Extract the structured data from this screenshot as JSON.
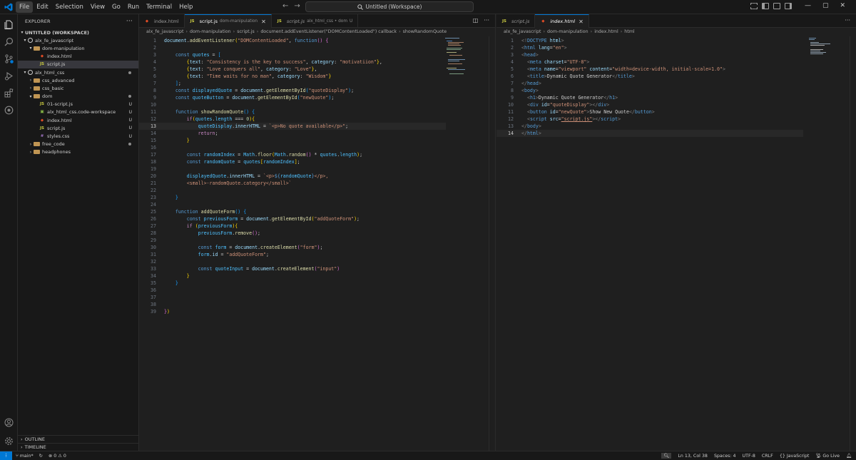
{
  "menu": [
    "File",
    "Edit",
    "Selection",
    "View",
    "Go",
    "Run",
    "Terminal",
    "Help"
  ],
  "command_center": "Untitled (Workspace)",
  "window_controls": [
    "—",
    "▢",
    "✕"
  ],
  "explorer": {
    "title": "EXPLORER",
    "workspace": "UNTITLED (WORKSPACE)",
    "rows": [
      {
        "label": "alx_fe_javascript",
        "indent": 0,
        "kind": "repo",
        "twisty": "▾"
      },
      {
        "label": "dom-manipulation",
        "indent": 1,
        "kind": "folder",
        "twisty": "▾"
      },
      {
        "label": "index.html",
        "indent": 2,
        "kind": "html"
      },
      {
        "label": "script.js",
        "indent": 2,
        "kind": "js",
        "selected": true
      },
      {
        "label": "alx_html_css",
        "indent": 0,
        "kind": "repo",
        "twisty": "▾",
        "dot": true
      },
      {
        "label": "css_advanced",
        "indent": 1,
        "kind": "folder",
        "twisty": "›"
      },
      {
        "label": "css_basic",
        "indent": 1,
        "kind": "folder",
        "twisty": "›"
      },
      {
        "label": "dom",
        "indent": 1,
        "kind": "folder",
        "twisty": "▾",
        "dot": true
      },
      {
        "label": "01-script.js",
        "indent": 2,
        "kind": "js",
        "badge": "U"
      },
      {
        "label": "alx_html_css.code-workspace",
        "indent": 2,
        "kind": "ws",
        "badge": "U"
      },
      {
        "label": "index.html",
        "indent": 2,
        "kind": "html",
        "badge": "U"
      },
      {
        "label": "script.js",
        "indent": 2,
        "kind": "js",
        "badge": "U"
      },
      {
        "label": "styles.css",
        "indent": 2,
        "kind": "css",
        "badge": "U"
      },
      {
        "label": "free_code",
        "indent": 1,
        "kind": "folder",
        "twisty": "›",
        "dot": true
      },
      {
        "label": "headphones",
        "indent": 1,
        "kind": "folder",
        "twisty": "›"
      }
    ],
    "outline": "OUTLINE",
    "timeline": "TIMELINE"
  },
  "left_editor": {
    "tabs": [
      {
        "name": "index.html",
        "desc": "",
        "kind": "html"
      },
      {
        "name": "script.js",
        "desc": "dom-manipulation",
        "kind": "js",
        "active": true,
        "close": "✕"
      },
      {
        "name": "script.js",
        "desc": "alx_html_css • dom",
        "kind": "js",
        "italic": true,
        "badge": "U"
      }
    ],
    "breadcrumb": [
      "alx_fe_javascript",
      "dom-manipulation",
      "script.js",
      "document.addEventListener(\"DOMContentLoaded\") callback",
      "showRandomQuote"
    ]
  },
  "right_editor": {
    "tabs": [
      {
        "name": "script.js",
        "desc": "",
        "kind": "js",
        "italic": true
      },
      {
        "name": "index.html",
        "desc": "",
        "kind": "html",
        "active": true,
        "italic": true,
        "close": "✕"
      }
    ],
    "breadcrumb": [
      "alx_fe_javascript",
      "dom-manipulation",
      "index.html",
      "html"
    ]
  },
  "status": {
    "branch": "main*",
    "problems": "⊗ 0 ⚠ 0",
    "position": "Ln 13, Col 38",
    "spaces": "Spaces: 4",
    "encoding": "UTF-8",
    "eol": "CRLF",
    "language": "{} JavaScript",
    "golive": "Go Live"
  }
}
